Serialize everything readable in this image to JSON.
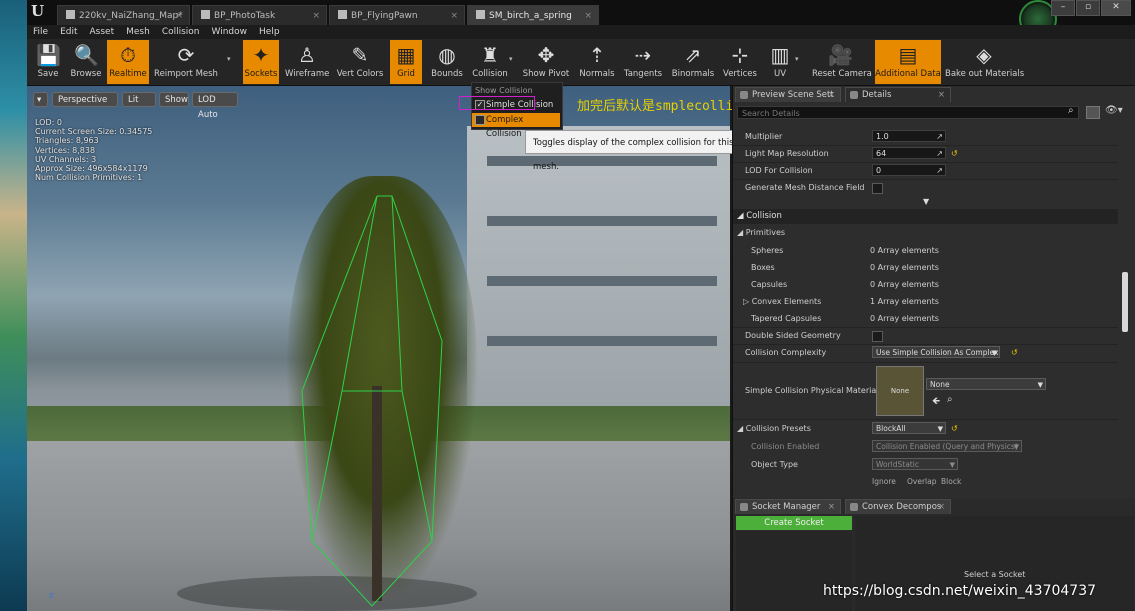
{
  "tabs": [
    {
      "label": "220kv_NaiZhang_Map*"
    },
    {
      "label": "BP_PhotoTask"
    },
    {
      "label": "BP_FlyingPawn"
    },
    {
      "label": "SM_birch_a_spring"
    }
  ],
  "window_buttons": {
    "minimize": "–",
    "maximize": "▫",
    "close": "✕"
  },
  "menu": [
    "File",
    "Edit",
    "Asset",
    "Mesh",
    "Collision",
    "Window",
    "Help"
  ],
  "toolbar": [
    {
      "label": "Save",
      "icon": "save-icon"
    },
    {
      "label": "Browse",
      "icon": "browse-icon"
    },
    {
      "label": "Realtime",
      "icon": "realtime-icon",
      "active": true
    },
    {
      "label": "Reimport Mesh",
      "icon": "reimport-icon"
    },
    {
      "label": "Sockets",
      "icon": "sockets-icon",
      "active": true
    },
    {
      "label": "Wireframe",
      "icon": "wireframe-icon"
    },
    {
      "label": "Vert Colors",
      "icon": "vert-colors-icon"
    },
    {
      "label": "Grid",
      "icon": "grid-icon",
      "active": true
    },
    {
      "label": "Bounds",
      "icon": "bounds-icon"
    },
    {
      "label": "Collision",
      "icon": "collision-icon"
    },
    {
      "label": "Show Pivot",
      "icon": "pivot-icon"
    },
    {
      "label": "Normals",
      "icon": "normals-icon"
    },
    {
      "label": "Tangents",
      "icon": "tangents-icon"
    },
    {
      "label": "Binormals",
      "icon": "binormals-icon"
    },
    {
      "label": "Vertices",
      "icon": "vertices-icon"
    },
    {
      "label": "UV",
      "icon": "uv-icon"
    },
    {
      "label": "Reset Camera",
      "icon": "camera-icon"
    },
    {
      "label": "Additional Data",
      "icon": "additional-data-icon",
      "active": true
    },
    {
      "label": "Bake out Materials",
      "icon": "bake-icon"
    }
  ],
  "viewport": {
    "buttons": {
      "perspective": "Perspective",
      "lit": "Lit",
      "show": "Show",
      "lod": "LOD Auto"
    },
    "stats": [
      "LOD: 0",
      "Current Screen Size: 0.34575",
      "Triangles: 8,963",
      "Vertices: 8,838",
      "UV Channels: 3",
      "Approx Size: 496x584x1179",
      "Num Collision Primitives: 1"
    ],
    "axis_label": "z"
  },
  "collision_menu": {
    "header": "Show Collision",
    "simple": "Simple Collision",
    "complex": "Complex Collision",
    "simple_checked": true
  },
  "tooltip": "Toggles display of the complex collision for this static mesh.",
  "annotation": "加完后默认是smplecollision",
  "panel": {
    "tabs": {
      "preview": "Preview Scene Sett",
      "details": "Details"
    },
    "search_placeholder": "Search Details",
    "rows": {
      "multiplier_label": "Multiplier",
      "multiplier_value": "1.0",
      "lightmap_label": "Light Map Resolution",
      "lightmap_value": "64",
      "lod_collision_label": "LOD For Collision",
      "lod_collision_value": "0",
      "gen_distance_label": "Generate Mesh Distance Field"
    },
    "collision_header": "Collision",
    "primitives_header": "Primitives",
    "primitives": [
      {
        "label": "Spheres",
        "value": "0 Array elements"
      },
      {
        "label": "Boxes",
        "value": "0 Array elements"
      },
      {
        "label": "Capsules",
        "value": "0 Array elements"
      },
      {
        "label": "Convex Elements",
        "value": "1 Array elements"
      },
      {
        "label": "Tapered Capsules",
        "value": "0 Array elements"
      }
    ],
    "double_sided": "Double Sided Geometry",
    "complexity_label": "Collision Complexity",
    "complexity_value": "Use Simple Collision As Complex",
    "phys_mat_label": "Simple Collision Physical Material",
    "phys_mat_thumb": "None",
    "phys_mat_value": "None",
    "presets_label": "Collision Presets",
    "presets_value": "BlockAll",
    "enabled_label": "Collision Enabled",
    "enabled_value": "Collision Enabled (Query and Physics)",
    "object_type_label": "Object Type",
    "object_type_value": "WorldStatic",
    "resp_cols": [
      "Ignore",
      "Overlap",
      "Block"
    ]
  },
  "bottom": {
    "tabs": {
      "socket": "Socket Manager",
      "convex": "Convex Decompos"
    },
    "create_socket": "Create Socket",
    "select_socket": "Select a Socket"
  },
  "watermark": "https://blog.csdn.net/weixin_43704737"
}
